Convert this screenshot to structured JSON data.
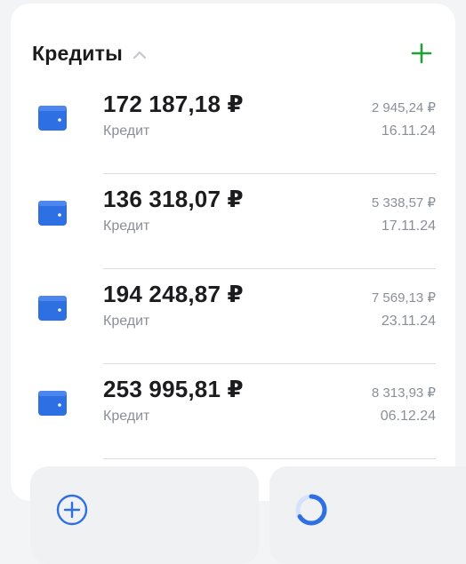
{
  "colors": {
    "accent_blue": "#2f6fe4",
    "accent_green": "#21a038",
    "text_primary": "#1c1c1e",
    "text_secondary": "#8a8f98"
  },
  "section": {
    "title": "Кредиты",
    "collapse_icon": "chevron-up-icon",
    "add_icon": "plus-icon"
  },
  "loans": [
    {
      "amount": "172 187,18 ₽",
      "label": "Кредит",
      "payment": "2 945,24 ₽",
      "date": "16.11.24",
      "icon": "wallet-icon"
    },
    {
      "amount": "136 318,07 ₽",
      "label": "Кредит",
      "payment": "5 338,57 ₽",
      "date": "17.11.24",
      "icon": "wallet-icon"
    },
    {
      "amount": "194 248,87 ₽",
      "label": "Кредит",
      "payment": "7 569,13 ₽",
      "date": "23.11.24",
      "icon": "wallet-icon"
    },
    {
      "amount": "253 995,81 ₽",
      "label": "Кредит",
      "payment": "8 313,93 ₽",
      "date": "06.12.24",
      "icon": "wallet-icon"
    }
  ],
  "tiles": [
    {
      "icon": "plus-circle-icon"
    },
    {
      "icon": "loading-ring-icon"
    }
  ]
}
